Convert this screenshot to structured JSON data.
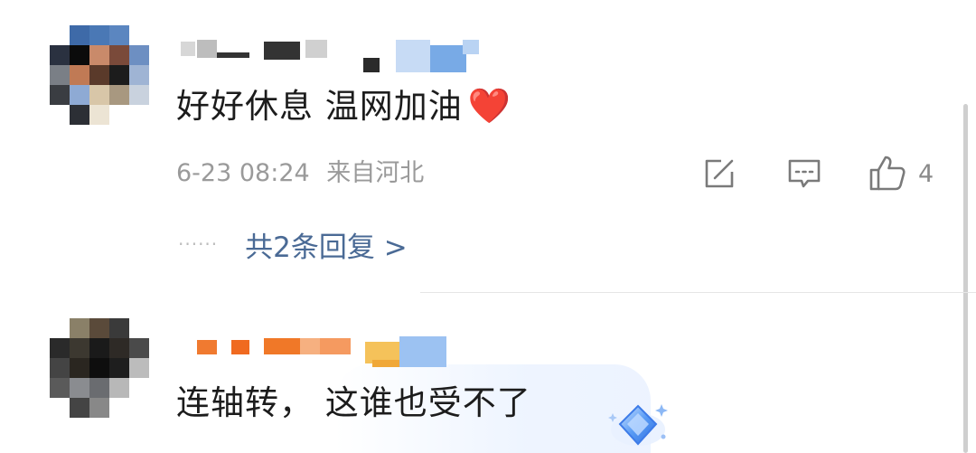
{
  "comments": [
    {
      "text": "好好休息 温网加油",
      "heart": "❤️",
      "timestamp": "6-23 08:24",
      "location": "来自河北",
      "like_count": "4",
      "replies_dots": "······",
      "replies_label": "共2条回复 >"
    },
    {
      "text": "连轴转， 这谁也受不了"
    }
  ],
  "icons": {
    "share": "share-icon",
    "reply": "comment-icon",
    "like": "thumbs-up-icon",
    "badge": "diamond-badge-icon"
  },
  "colors": {
    "reply_link": "#4a6a95",
    "meta": "#9a9a9a",
    "heart": "#e8232d",
    "divider": "#e6e6e6"
  }
}
